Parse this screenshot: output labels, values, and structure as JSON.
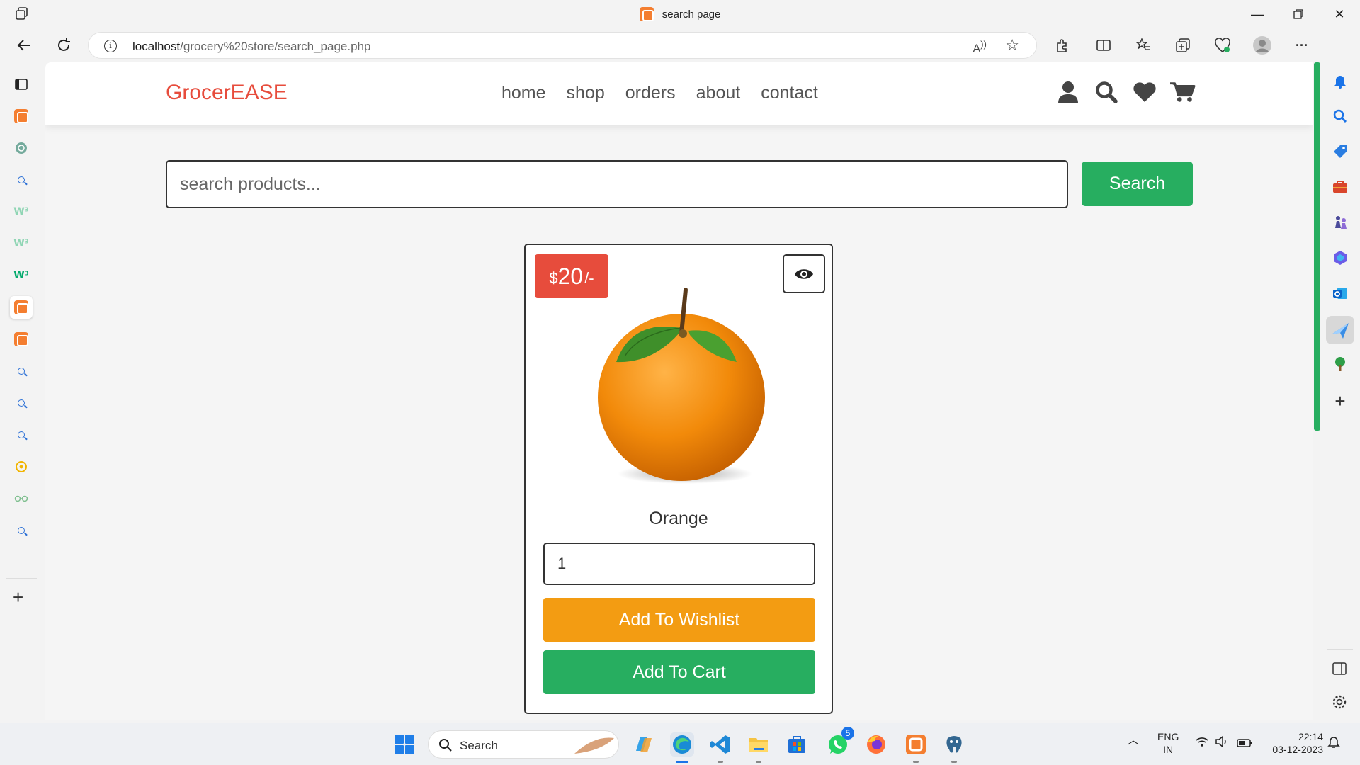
{
  "browser": {
    "tab_title": "search page",
    "url_host": "localhost",
    "url_path": "/grocery%20store/search_page.php"
  },
  "site": {
    "logo": "GrocerEASE",
    "nav": [
      {
        "label": "home"
      },
      {
        "label": "shop"
      },
      {
        "label": "orders"
      },
      {
        "label": "about"
      },
      {
        "label": "contact"
      }
    ],
    "header_icons": [
      "user-icon",
      "search-icon",
      "heart-icon",
      "cart-icon"
    ]
  },
  "search": {
    "placeholder": "search products...",
    "button_label": "Search"
  },
  "product": {
    "currency": "$",
    "price": "20",
    "price_suffix": "/-",
    "name": "Orange",
    "quantity": "1",
    "wishlist_label": "Add To Wishlist",
    "cart_label": "Add To Cart"
  },
  "taskbar": {
    "search_label": "Search",
    "whatsapp_badge": "5",
    "lang": "ENG",
    "region": "IN",
    "time": "22:14",
    "date": "03-12-2023"
  },
  "colors": {
    "brand_red": "#e74c3c",
    "green": "#27ae60",
    "orange": "#f39c12"
  }
}
